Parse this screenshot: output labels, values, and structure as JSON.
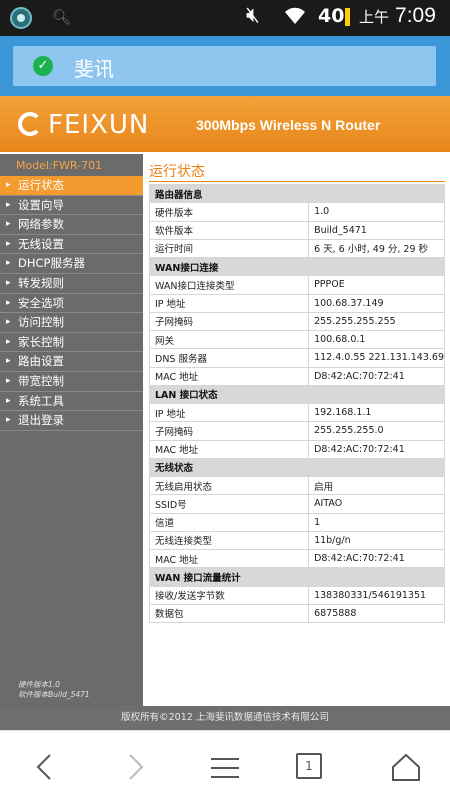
{
  "status_bar": {
    "signal": "40",
    "ampm": "上午",
    "time": "7:09"
  },
  "browser": {
    "title": "斐讯"
  },
  "router": {
    "logo": "FEIXUN",
    "title": "300Mbps Wireless N Router",
    "model": "Model:FWR-701",
    "menu": [
      {
        "label": "运行状态",
        "active": true
      },
      {
        "label": "设置向导"
      },
      {
        "label": "网络参数"
      },
      {
        "label": "无线设置"
      },
      {
        "label": "DHCP服务器"
      },
      {
        "label": "转发规则"
      },
      {
        "label": "安全选项"
      },
      {
        "label": "访问控制"
      },
      {
        "label": "家长控制"
      },
      {
        "label": "路由设置"
      },
      {
        "label": "带宽控制"
      },
      {
        "label": "系统工具"
      },
      {
        "label": "退出登录"
      }
    ],
    "hw_version": "硬件版本1.0",
    "sw_version": "软件版本Build_5471",
    "content_title": "运行状态",
    "sections": [
      {
        "title": "路由器信息",
        "rows": [
          {
            "k": "硬件版本",
            "v": "1.0"
          },
          {
            "k": "软件版本",
            "v": "Build_5471"
          },
          {
            "k": "运行时间",
            "v": "6 天, 6 小时, 49 分, 29 秒"
          }
        ]
      },
      {
        "title": "WAN接口连接",
        "rows": [
          {
            "k": "WAN接口连接类型",
            "v": "PPPOE"
          },
          {
            "k": "IP 地址",
            "v": "100.68.37.149"
          },
          {
            "k": "子网掩码",
            "v": "255.255.255.255"
          },
          {
            "k": "网关",
            "v": "100.68.0.1"
          },
          {
            "k": "DNS 服务器",
            "v": "112.4.0.55 221.131.143.69"
          },
          {
            "k": "MAC 地址",
            "v": "D8:42:AC:70:72:41"
          }
        ]
      },
      {
        "title": "LAN 接口状态",
        "rows": [
          {
            "k": "IP 地址",
            "v": "192.168.1.1"
          },
          {
            "k": "子网掩码",
            "v": "255.255.255.0"
          },
          {
            "k": "MAC 地址",
            "v": "D8:42:AC:70:72:41"
          }
        ]
      },
      {
        "title": "无线状态",
        "rows": [
          {
            "k": "无线启用状态",
            "v": "启用"
          },
          {
            "k": "SSID号",
            "v": "AITAO"
          },
          {
            "k": "信道",
            "v": "1"
          },
          {
            "k": "无线连接类型",
            "v": "11b/g/n"
          },
          {
            "k": "MAC 地址",
            "v": "D8:42:AC:70:72:41"
          }
        ]
      },
      {
        "title": "WAN 接口流量统计",
        "rows": [
          {
            "k": "接收/发送字节数",
            "v": "138380331/546191351"
          },
          {
            "k": "数据包",
            "v": "6875888"
          }
        ]
      }
    ],
    "footer": "版权所有©2012 上海斐讯数据通信技术有限公司"
  },
  "navbar": {
    "tab_count": "1"
  },
  "colors": {
    "orange": "#f39b2f",
    "sidebar": "#6b6b6b",
    "browser_blue": "#3c97d8"
  }
}
